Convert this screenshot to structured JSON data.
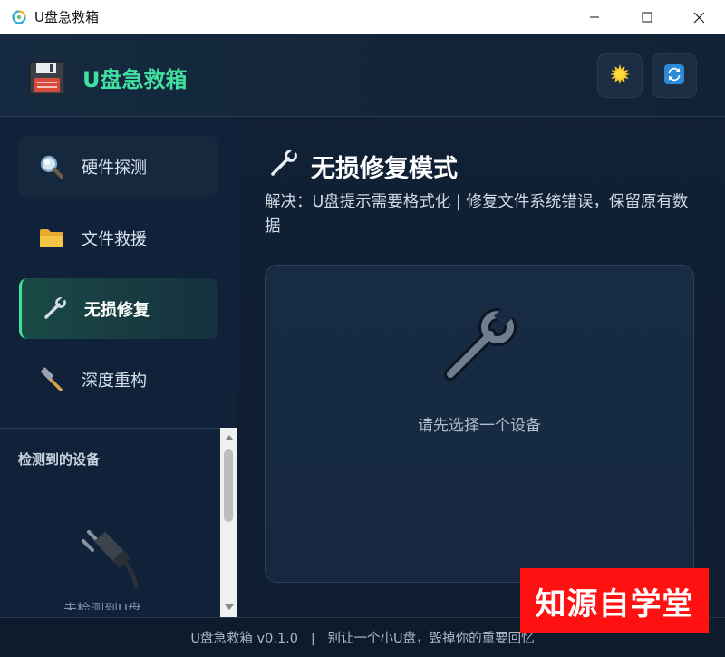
{
  "window": {
    "title": "U盘急救箱",
    "icon": "app-logo-icon",
    "controls": [
      "minimize",
      "maximize",
      "close"
    ]
  },
  "header": {
    "app_name": "U盘急救箱",
    "logo_icon": "floppy-disk-icon",
    "buttons": [
      {
        "name": "theme-toggle",
        "icon": "sun-icon"
      },
      {
        "name": "refresh",
        "icon": "refresh-icon"
      }
    ]
  },
  "sidebar": {
    "items": [
      {
        "label": "硬件探测",
        "icon": "magnifier-icon",
        "state": "hover"
      },
      {
        "label": "文件救援",
        "icon": "folder-icon",
        "state": "normal"
      },
      {
        "label": "无损修复",
        "icon": "wrench-icon",
        "state": "active"
      },
      {
        "label": "深度重构",
        "icon": "hammer-icon",
        "state": "normal"
      }
    ],
    "devices_title": "检测到的设备",
    "devices_empty_icon": "plug-icon",
    "devices_empty_text": "未检测到U盘"
  },
  "main": {
    "title": "无损修复模式",
    "title_icon": "wrench-icon",
    "description": "解决：U盘提示需要格式化 | 修复文件系统错误，保留原有数据",
    "empty_icon": "wrench-icon",
    "empty_message": "请先选择一个设备"
  },
  "footer": {
    "text": "U盘急救箱 v0.1.0   |   别让一个小U盘，毁掉你的重要回忆"
  },
  "watermark": {
    "text": "知源自学堂"
  },
  "colors": {
    "accent": "#42e0a0",
    "background": "#112136",
    "watermark": "#ff1111"
  }
}
